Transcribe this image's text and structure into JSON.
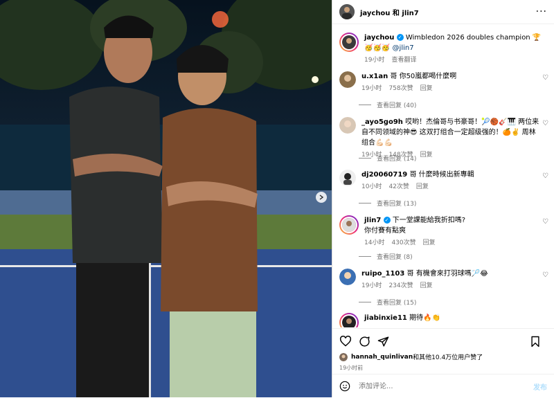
{
  "header": {
    "usernames": "jaychou 和 jlin7",
    "more_icon": "more-horizontal-icon",
    "more_label": "···"
  },
  "caption": {
    "username": "jaychou",
    "text": "Wimbledon 2026 doubles champion 🏆",
    "line2_emojis": "🥳🥳🥳",
    "mention": "@jlin7",
    "time": "19小时",
    "translate": "查看翻译"
  },
  "comments": [
    {
      "username": "u.x1an",
      "text": "哥 你50嵐都喝什麼啊",
      "time": "19小时",
      "likes": "758次赞",
      "reply": "回复",
      "replies": "查看回复 (40)"
    },
    {
      "username": "_ayo5go9h",
      "text": "哎哟！杰倫哥与书豪哥！🎾🏀🎸🎹 两位来自不同领域的神😎 这双打组合一定超级强的！🍊✌️ 周林组合💪🏻💪🏻",
      "time": "19小时",
      "likes": "148次赞",
      "reply": "回复",
      "replies": "查看回复 (14)"
    },
    {
      "username": "dj20060719",
      "text": "哥 什麼時候出新專輯",
      "time": "10小时",
      "likes": "42次赞",
      "reply": "回复",
      "replies": "查看回复 (13)"
    },
    {
      "username": "jlin7",
      "text": "下一堂課能給我折扣嗎?",
      "text2": "你付賽有點爽",
      "time": "14小时",
      "likes": "430次赞",
      "reply": "回复",
      "replies": "查看回复 (8)"
    },
    {
      "username": "ruipo_1103",
      "text": "哥 有機會來打羽球嗎🏸😂",
      "time": "19小时",
      "likes": "234次赞",
      "reply": "回复",
      "replies": "查看回复 (15)"
    },
    {
      "username": "jiabinxie11",
      "text": "期待🔥👏",
      "time": "",
      "likes": "",
      "reply": "",
      "replies": ""
    }
  ],
  "actions": {
    "like_icon": "heart-icon",
    "comment_icon": "comment-icon",
    "share_icon": "share-icon",
    "save_icon": "bookmark-icon"
  },
  "likes_text": {
    "name": "hannah_quinlivan",
    "rest": "和其他10.4万位用户赞了"
  },
  "post_time": "19小时前",
  "add_comment": {
    "placeholder": "添加评论...",
    "post_label": "发布"
  },
  "colors": {
    "accent": "#0095f6",
    "muted": "#737373",
    "court_blue": "#2f4f8f",
    "court_green": "#5d7a3a"
  }
}
